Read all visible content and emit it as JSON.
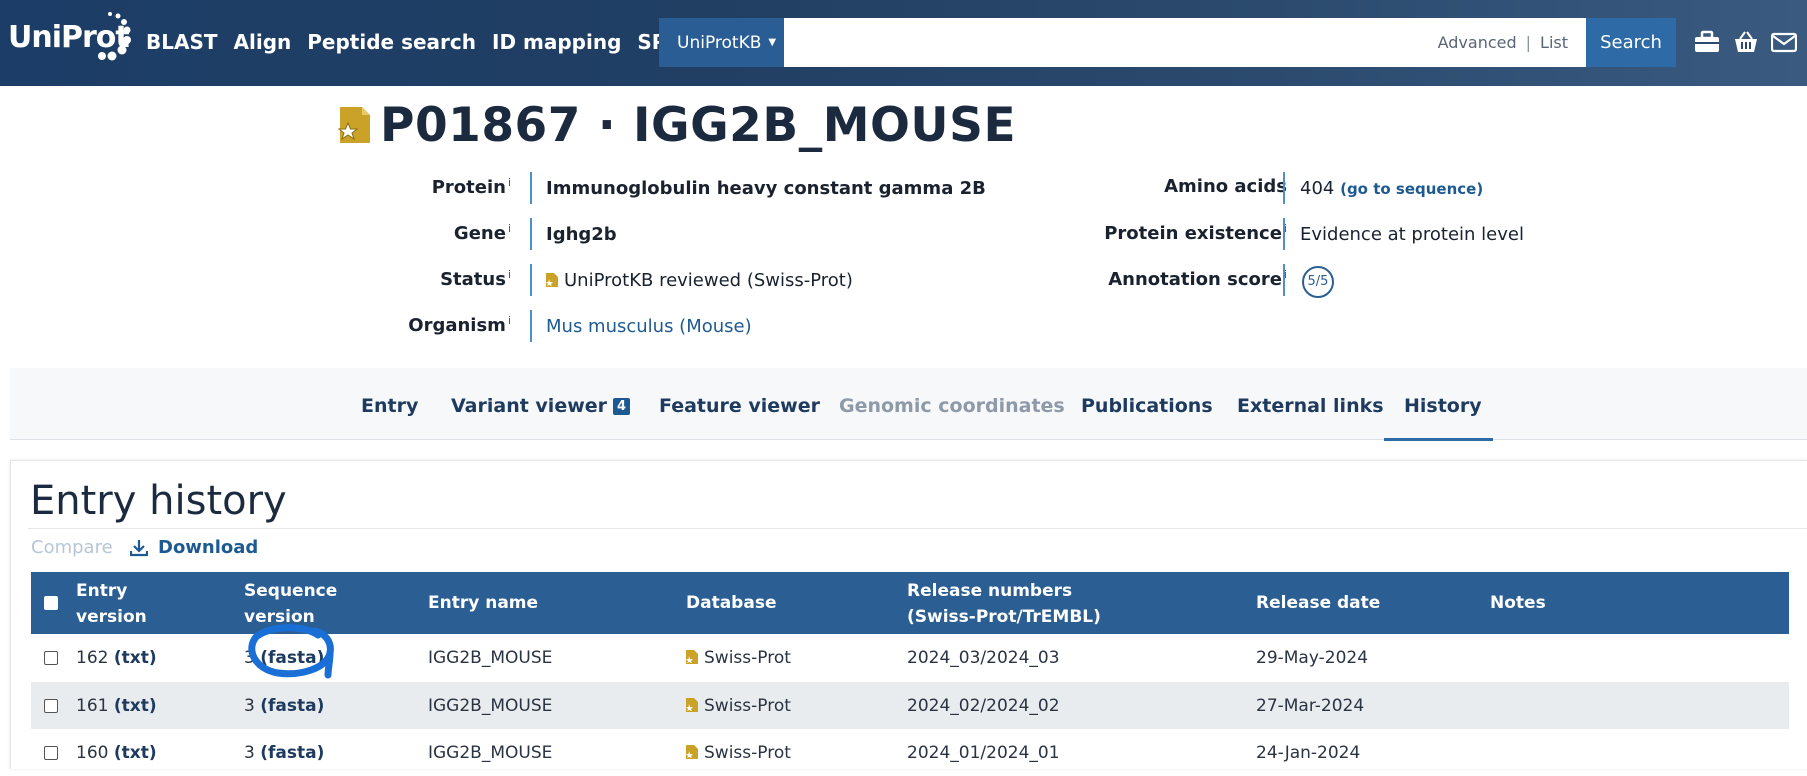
{
  "header": {
    "logo": "UniProt",
    "nav": [
      "BLAST",
      "Align",
      "Peptide search",
      "ID mapping",
      "SPARQL"
    ],
    "db_select": "UniProtKB",
    "search_placeholder": "",
    "advanced": "Advanced",
    "list": "List",
    "search_button": "Search",
    "icons": [
      "toolbox-icon",
      "basket-icon",
      "mail-icon"
    ]
  },
  "entry": {
    "title": "P01867 · IGG2B_MOUSE",
    "protein_label": "Protein",
    "protein": "Immunoglobulin heavy constant gamma 2B",
    "gene_label": "Gene",
    "gene": "Ighg2b",
    "status_label": "Status",
    "status": "UniProtKB reviewed (Swiss-Prot)",
    "organism_label": "Organism",
    "organism": "Mus musculus (Mouse)",
    "amino_label": "Amino acids",
    "amino": "404",
    "go_to_sequence": "(go to sequence)",
    "existence_label": "Protein existence",
    "existence": "Evidence at protein level",
    "score_label": "Annotation score",
    "score": "5/5",
    "info_mark": "i"
  },
  "tabs": [
    {
      "label": "Entry"
    },
    {
      "label": "Variant viewer",
      "badge": "4"
    },
    {
      "label": "Feature viewer"
    },
    {
      "label": "Genomic coordinates",
      "disabled": true
    },
    {
      "label": "Publications"
    },
    {
      "label": "External links"
    },
    {
      "label": "History",
      "active": true
    }
  ],
  "history": {
    "title": "Entry history",
    "compare": "Compare",
    "download": "Download",
    "columns": {
      "entry_version_1": "Entry",
      "entry_version_2": "version",
      "sequence_version_1": "Sequence",
      "sequence_version_2": "version",
      "entry_name": "Entry name",
      "database": "Database",
      "release_numbers_1": "Release numbers",
      "release_numbers_2": "(Swiss-Prot/TrEMBL)",
      "release_date": "Release date",
      "notes": "Notes"
    },
    "rows": [
      {
        "entry_version": "162",
        "txt": "(txt)",
        "seq_version": "3",
        "fasta": "(fasta)",
        "entry_name": "IGG2B_MOUSE",
        "database": "Swiss-Prot",
        "release": "2024_03/2024_03",
        "date": "29-May-2024"
      },
      {
        "entry_version": "161",
        "txt": "(txt)",
        "seq_version": "3",
        "fasta": "(fasta)",
        "entry_name": "IGG2B_MOUSE",
        "database": "Swiss-Prot",
        "release": "2024_02/2024_02",
        "date": "27-Mar-2024"
      },
      {
        "entry_version": "160",
        "txt": "(txt)",
        "seq_version": "3",
        "fasta": "(fasta)",
        "entry_name": "IGG2B_MOUSE",
        "database": "Swiss-Prot",
        "release": "2024_01/2024_01",
        "date": "24-Jan-2024"
      }
    ]
  },
  "colors": {
    "header_bg": "#1c3d67",
    "accent": "#2b5f94",
    "annotation_ink": "#1a6fd6",
    "swissprot_gold": "#c9a227"
  }
}
